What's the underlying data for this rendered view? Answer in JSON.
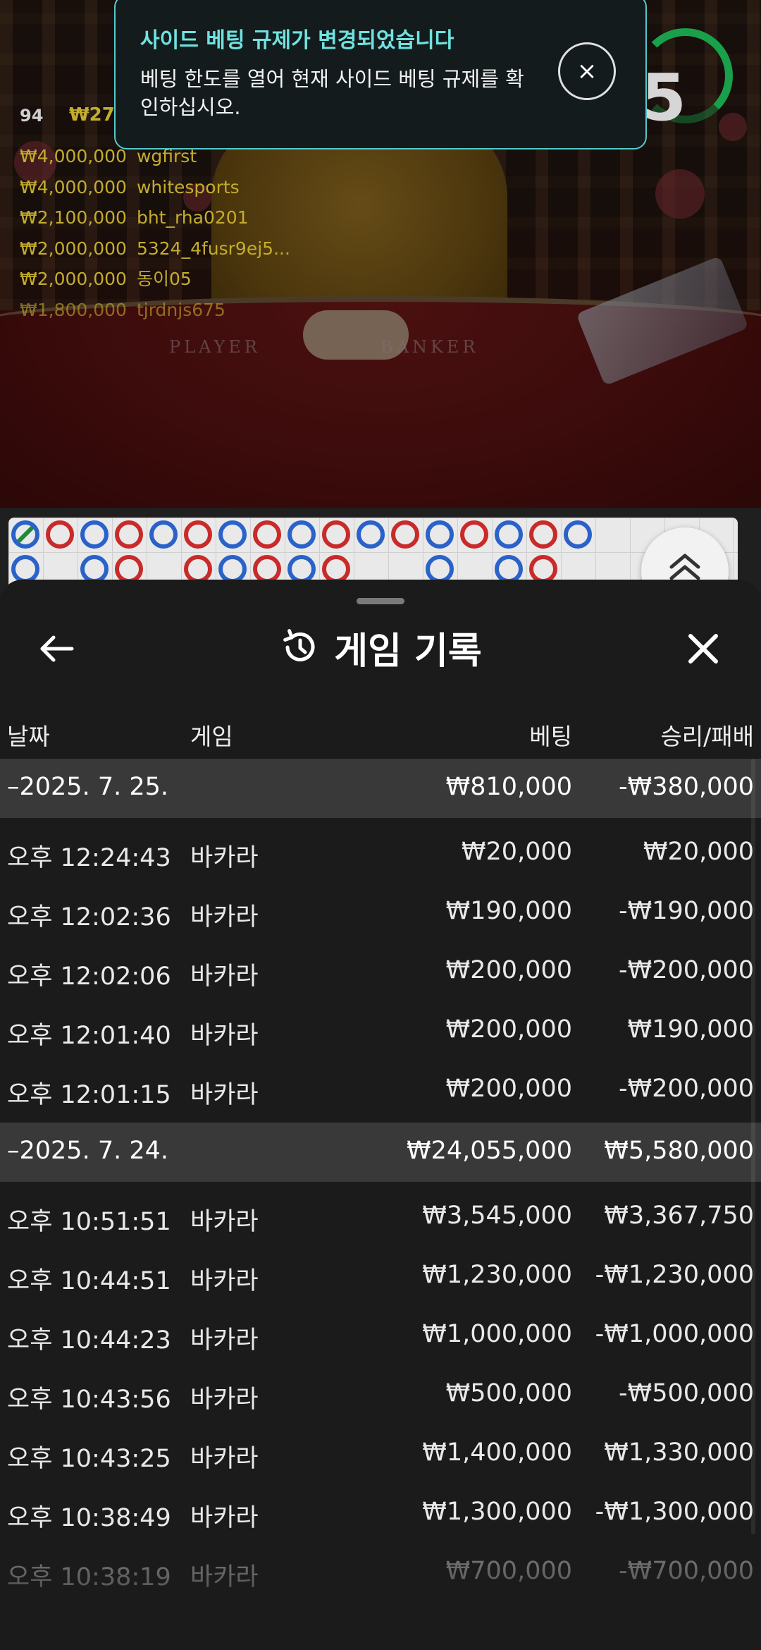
{
  "video": {
    "viewer_count": "94",
    "viewer_total": "₩27,",
    "timer_value": "5",
    "felt_left": "PLAYER",
    "felt_right": "BANKER",
    "leaderboard": [
      {
        "amount": "₩4,000,000",
        "user": "wgfirst"
      },
      {
        "amount": "₩4,000,000",
        "user": "whitesports"
      },
      {
        "amount": "₩2,100,000",
        "user": "bht_rha0201"
      },
      {
        "amount": "₩2,000,000",
        "user": "5324_4fusr9ej5..."
      },
      {
        "amount": "₩2,000,000",
        "user": "동이05"
      },
      {
        "amount": "₩1,800,000",
        "user": "tjrdnjs675"
      }
    ]
  },
  "toast": {
    "title": "사이드 베팅 규제가 변경되었습니다",
    "body": "베팅 한도를 열어 현재 사이드 베팅 규제를 확인하십시오.",
    "close_icon": "×"
  },
  "road": {
    "beads_row1": [
      "tie",
      "p",
      "b",
      "p",
      "b",
      "p",
      "b",
      "p",
      "b",
      "p",
      "b",
      "p",
      "b",
      "p",
      "b",
      "p",
      "b"
    ],
    "beads_row2": [
      "b",
      "",
      "b",
      "p",
      "",
      "p",
      "b",
      "p",
      "b",
      "p",
      "",
      "",
      "b",
      "",
      "b",
      "p",
      ""
    ]
  },
  "sheet": {
    "title": "게임 기록",
    "columns": {
      "date": "날짜",
      "game": "게임",
      "bet": "베팅",
      "result": "승리/패배"
    },
    "groups": [
      {
        "date": "–2025. 7. 25.",
        "bet": "₩810,000",
        "result": "-₩380,000",
        "rows": [
          {
            "time": "오후 12:24:43",
            "game": "바카라",
            "bet": "₩20,000",
            "result": "₩20,000"
          },
          {
            "time": "오후 12:02:36",
            "game": "바카라",
            "bet": "₩190,000",
            "result": "-₩190,000"
          },
          {
            "time": "오후 12:02:06",
            "game": "바카라",
            "bet": "₩200,000",
            "result": "-₩200,000"
          },
          {
            "time": "오후 12:01:40",
            "game": "바카라",
            "bet": "₩200,000",
            "result": "₩190,000"
          },
          {
            "time": "오후 12:01:15",
            "game": "바카라",
            "bet": "₩200,000",
            "result": "-₩200,000"
          }
        ]
      },
      {
        "date": "–2025. 7. 24.",
        "bet": "₩24,055,000",
        "result": "₩5,580,000",
        "rows": [
          {
            "time": "오후 10:51:51",
            "game": "바카라",
            "bet": "₩3,545,000",
            "result": "₩3,367,750"
          },
          {
            "time": "오후 10:44:51",
            "game": "바카라",
            "bet": "₩1,230,000",
            "result": "-₩1,230,000"
          },
          {
            "time": "오후 10:44:23",
            "game": "바카라",
            "bet": "₩1,000,000",
            "result": "-₩1,000,000"
          },
          {
            "time": "오후 10:43:56",
            "game": "바카라",
            "bet": "₩500,000",
            "result": "-₩500,000"
          },
          {
            "time": "오후 10:43:25",
            "game": "바카라",
            "bet": "₩1,400,000",
            "result": "₩1,330,000"
          },
          {
            "time": "오후 10:38:49",
            "game": "바카라",
            "bet": "₩1,300,000",
            "result": "-₩1,300,000"
          },
          {
            "time": "오후 10:38:19",
            "game": "바카라",
            "bet": "₩700,000",
            "result": "-₩700,000"
          }
        ]
      }
    ]
  },
  "colors": {
    "toast_border": "#55c9c9",
    "toast_title": "#6ee3e0",
    "leaderboard_text": "#c3ad2d",
    "timer_ring": "#1aa04a",
    "banker_red": "#c92a2a",
    "player_blue": "#2a62c9",
    "group_row_bg": "#393939",
    "sheet_bg": "#1b1b1b"
  },
  "icons": {
    "back": "arrow-left-icon",
    "history": "history-icon",
    "close": "close-icon",
    "expand": "chevron-double-up-icon"
  }
}
